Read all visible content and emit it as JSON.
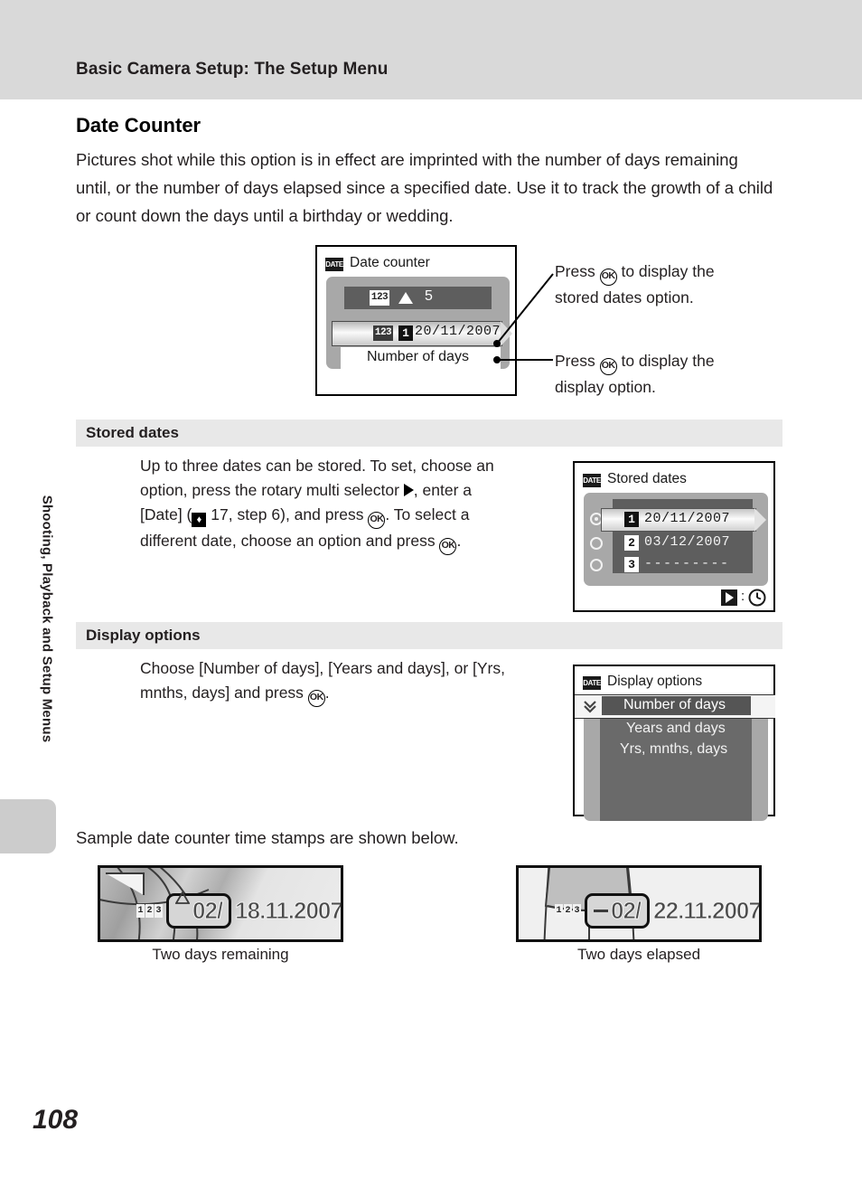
{
  "header": {
    "running_title": "Basic Camera Setup: The Setup Menu"
  },
  "sidebar": {
    "tab_label": "Shooting, Playback and Setup Menus"
  },
  "page": {
    "number": "108"
  },
  "section": {
    "title": "Date Counter",
    "intro": "Pictures shot while this option is in effect are imprinted with the number of days remaining until, or the number of days elapsed since a specified date. Use it to track the growth of a child or count down the days until a birthday or wedding."
  },
  "screen_date_counter": {
    "icon": "date-icon",
    "icon_label": "DATE",
    "title": "Date counter",
    "row_counter_icon": "123",
    "row_counter_marker": "triangle-up-icon",
    "row_counter_value": "5",
    "row_date_icon": "123",
    "row_date_slot": "1",
    "row_date_value": "20/11/2007",
    "row_display_option": "Number of days"
  },
  "callouts": [
    {
      "text": "Press Ⓚ to display the stored dates option.",
      "line1_pre": "Press ",
      "line1_post": " to display the",
      "line2": "stored dates option.",
      "ok_label": "OK"
    },
    {
      "text": "Press Ⓚ to display the display option.",
      "line1_pre": "Press ",
      "line1_post": " to display the",
      "line2": "display option.",
      "ok_label": "OK"
    }
  ],
  "stored_dates": {
    "band_label": "Stored dates",
    "body_lines": [
      "Up to three dates can be stored. To set, choose an",
      "option, press the rotary multi selector ▶, enter a",
      "[Date] (■ 17, step 6), and press Ⓚ. To select a",
      "different date, choose an option and press Ⓚ."
    ],
    "body_l1": "Up to three dates can be stored. To set, choose an",
    "body_l2_pre": "option, press the rotary multi selector ",
    "body_l2_post": ", enter a",
    "body_l3_a": "[Date] (",
    "body_l3_b": " 17, step 6), and press ",
    "body_l3_c": ". To select a",
    "body_l4_pre": "different date, choose an option and press ",
    "body_l4_post": ".",
    "screen": {
      "icon_label": "DATE",
      "title": "Stored dates",
      "rows": [
        {
          "selected": true,
          "slot": "1",
          "value": "20/11/2007"
        },
        {
          "selected": false,
          "slot": "2",
          "value": "03/12/2007"
        },
        {
          "selected": false,
          "slot": "3",
          "value": "---------"
        }
      ],
      "footer_button": "right-arrow-icon",
      "footer_separator": ":",
      "footer_icon": "clock-icon"
    }
  },
  "display_options": {
    "band_label": "Display options",
    "body_l1": "Choose [Number of days], [Years and days], or [Yrs,",
    "body_l2_pre": "mnths, days] and press ",
    "body_l2_post": ".",
    "screen": {
      "icon_label": "DATE",
      "title": "Display options",
      "cursor_icon": "chevron-double-down-icon",
      "options": [
        {
          "label": "Number of days",
          "selected": true
        },
        {
          "label": "Years and days",
          "selected": false
        },
        {
          "label": "Yrs, mnths, days",
          "selected": false
        }
      ]
    }
  },
  "samples": {
    "lead_in": "Sample date counter time stamps are shown below.",
    "items": [
      {
        "counter_digits": [
          "1",
          "2",
          "3"
        ],
        "marker": "triangle-up-icon",
        "days": "02/",
        "date": "18.11.2007",
        "caption": "Two days remaining"
      },
      {
        "counter_digits": [
          "1",
          "2",
          "3"
        ],
        "marker": "minus-icon",
        "days": "02/",
        "date": "22.11.2007",
        "caption": "Two days elapsed"
      }
    ]
  },
  "colors": {
    "header_band": "#d9d9d9",
    "section_band": "#e8e8e8",
    "screen_bg_outer": "#d2d2d2",
    "screen_bg_inner": "#8a8a8a",
    "screen_inner_dark": "#5e5e5e",
    "text": "#231f20"
  }
}
